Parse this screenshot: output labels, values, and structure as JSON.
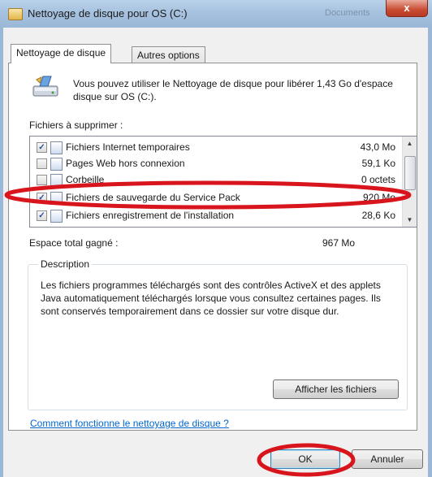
{
  "window": {
    "title": "Nettoyage de disque pour OS (C:)",
    "ghost_text": "Documents",
    "close_glyph": "x"
  },
  "tabs": [
    {
      "label": "Nettoyage de disque",
      "active": true
    },
    {
      "label": "Autres options",
      "active": false
    }
  ],
  "intro_text": "Vous pouvez utiliser le Nettoyage de disque pour libérer 1,43 Go d'espace disque sur OS (C:).",
  "files_label": "Fichiers à supprimer :",
  "files": [
    {
      "name": "Fichiers Internet temporaires",
      "size": "43,0 Mo",
      "checked": true,
      "icon": "document-icon"
    },
    {
      "name": "Pages Web hors connexion",
      "size": "59,1 Ko",
      "checked": false,
      "icon": "web-page-icon"
    },
    {
      "name": "Corbeille",
      "size": "0 octets",
      "checked": false,
      "icon": "recycle-bin-icon"
    },
    {
      "name": "Fichiers de sauvegarde du Service Pack",
      "size": "920 Mo",
      "checked": true,
      "icon": "service-pack-icon"
    },
    {
      "name": "Fichiers enregistrement de l'installation",
      "size": "28,6 Ko",
      "checked": true,
      "icon": "log-file-icon"
    }
  ],
  "total_label": "Espace total gagné :",
  "total_value": "967 Mo",
  "description_legend": "Description",
  "description_text": "Les fichiers programmes téléchargés sont des contrôles ActiveX et des applets Java automatiquement téléchargés lorsque vous consultez certaines pages. Ils sont conservés temporairement dans ce dossier sur votre disque dur.",
  "view_files_label": "Afficher les fichiers",
  "help_link": "Comment fonctionne le nettoyage de disque ?",
  "ok_label": "OK",
  "cancel_label": "Annuler",
  "colors": {
    "titlebar": "#a7c2df",
    "close_button": "#c84b32",
    "link": "#0066cc",
    "annotation": "#d8151c"
  },
  "icons": [
    "disk-cleanup-icon",
    "close-icon",
    "scroll-up-icon",
    "scroll-down-icon"
  ]
}
